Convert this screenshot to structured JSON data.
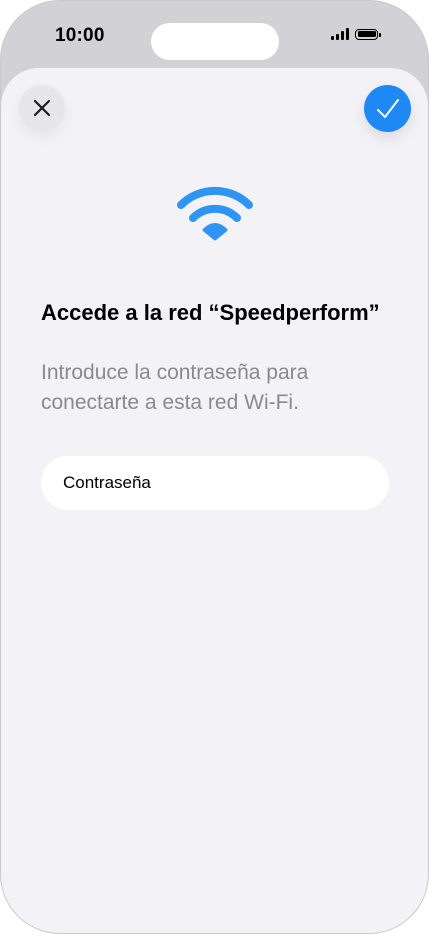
{
  "status_bar": {
    "time": "10:00"
  },
  "sheet": {
    "close_icon": "close-icon",
    "confirm_icon": "checkmark-icon",
    "wifi_icon": "wifi-icon",
    "title": "Accede a la red “Speedperform”",
    "subtitle": "Introduce la contraseña para conectarte a esta red Wi-Fi.",
    "password_field": {
      "placeholder": "Contraseña",
      "value": ""
    }
  },
  "colors": {
    "accent": "#1e88f5",
    "wifi": "#2f95f4",
    "sheet_background": "#f2f2f7",
    "frame_background": "#d1d1d6",
    "subtitle_text": "#8a8a8e"
  }
}
